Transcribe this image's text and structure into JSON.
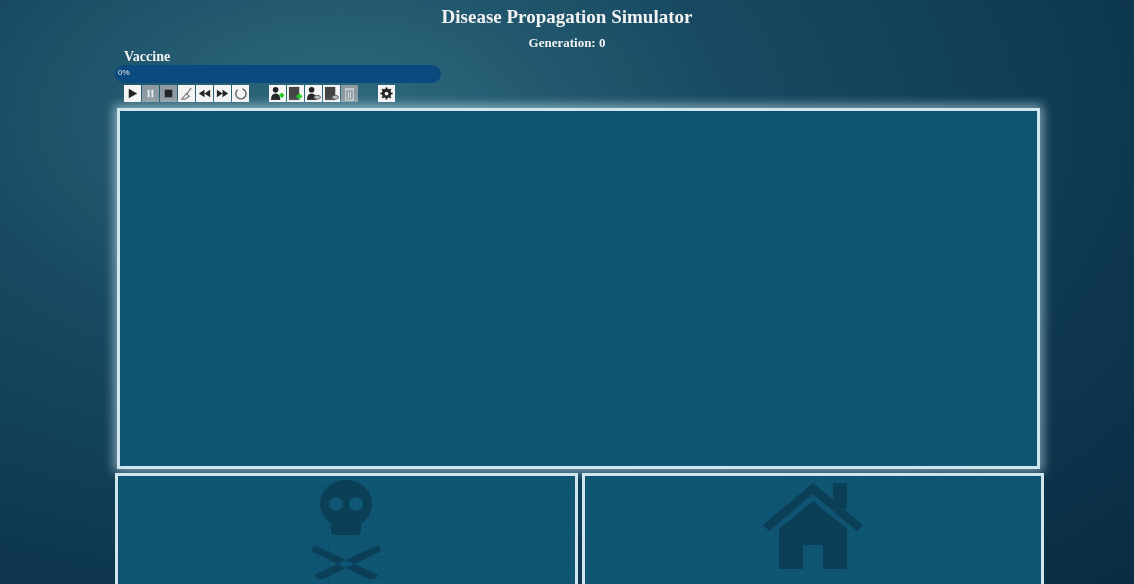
{
  "title": "Disease Propagation Simulator",
  "generation": "Generation: 0",
  "vaccine": {
    "label": "Vaccine",
    "reading": "0%"
  },
  "toolbar": [
    [
      {
        "kind": "play",
        "disabled": false
      },
      {
        "kind": "pause",
        "disabled": true
      },
      {
        "kind": "stop",
        "disabled": true
      },
      {
        "kind": "sweep",
        "disabled": false
      },
      {
        "kind": "rewind",
        "disabled": false
      },
      {
        "kind": "forward",
        "disabled": false
      },
      {
        "kind": "reset",
        "disabled": false
      }
    ],
    [
      {
        "kind": "add-person",
        "disabled": false
      },
      {
        "kind": "add-area",
        "disabled": false
      },
      {
        "kind": "view-person",
        "disabled": false
      },
      {
        "kind": "view-area",
        "disabled": false
      },
      {
        "kind": "trash",
        "disabled": true
      }
    ],
    [
      {
        "kind": "settings",
        "disabled": false
      }
    ]
  ]
}
